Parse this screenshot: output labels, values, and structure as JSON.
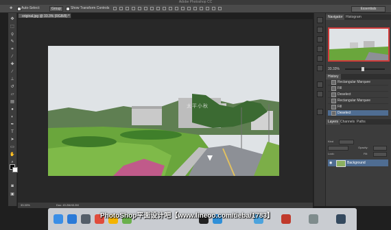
{
  "window": {
    "title": "Adobe Photoshop CC"
  },
  "options_bar": {
    "auto_select_label": "Auto-Select:",
    "auto_select_value": "Group",
    "show_transform_label": "Show Transform Controls",
    "workspace": "Essentials"
  },
  "document": {
    "tab_label": "original.jpg @ 33.3% (RGB/8) *",
    "watermark": "太平小秋",
    "zoom": "33.33%",
    "doc_size": "Doc: 43.2M/43.2M"
  },
  "panels": {
    "navigator_tabs": [
      "Navigator",
      "Histogram"
    ],
    "navigator_zoom": "33.33%",
    "history_tab": "History",
    "history_items": [
      "Rectangular Marquee",
      "Fill",
      "Deselect",
      "Rectangular Marquee",
      "Fill",
      "Deselect"
    ],
    "history_active_index": 5,
    "layers_tabs": [
      "Layers",
      "Channels",
      "Paths"
    ],
    "kind_label": "Kind",
    "opacity_label": "Opacity:",
    "lock_label": "Lock:",
    "fill_label": "Fill:",
    "layer_name": "Background"
  },
  "tools": [
    "move-tool",
    "marquee-tool",
    "lasso-tool",
    "quick-select-tool",
    "crop-tool",
    "eyedropper-tool",
    "healing-tool",
    "brush-tool",
    "stamp-tool",
    "history-brush-tool",
    "eraser-tool",
    "gradient-tool",
    "blur-tool",
    "dodge-tool",
    "pen-tool",
    "type-tool",
    "path-select-tool",
    "shape-tool",
    "hand-tool",
    "zoom-tool"
  ],
  "dock": {
    "caption": "PhotoShop平面设计吧【www.lineoo.com/tieba/1783】",
    "icons": [
      "finder-icon",
      "safari-icon",
      "launchpad-icon",
      "chrome-icon",
      "photos-icon",
      "app-icon",
      "qq-icon",
      "app-icon",
      "app-icon",
      "app-icon",
      "app-icon",
      "app-icon"
    ],
    "colors": [
      "#3a8ee6",
      "#2a7ad8",
      "#555f6a",
      "#e04c3c",
      "#f4b400",
      "#6ab04c",
      "#222222",
      "#2f8fd8",
      "#4ca3dd",
      "#c0392b",
      "#7f8c8d",
      "#34495e"
    ]
  },
  "colors": {
    "panel_bg": "#3c3c3c",
    "selection_blue": "#4f6d92",
    "canvas_bg": "#282828",
    "navigator_view_box": "#d23a3a"
  }
}
